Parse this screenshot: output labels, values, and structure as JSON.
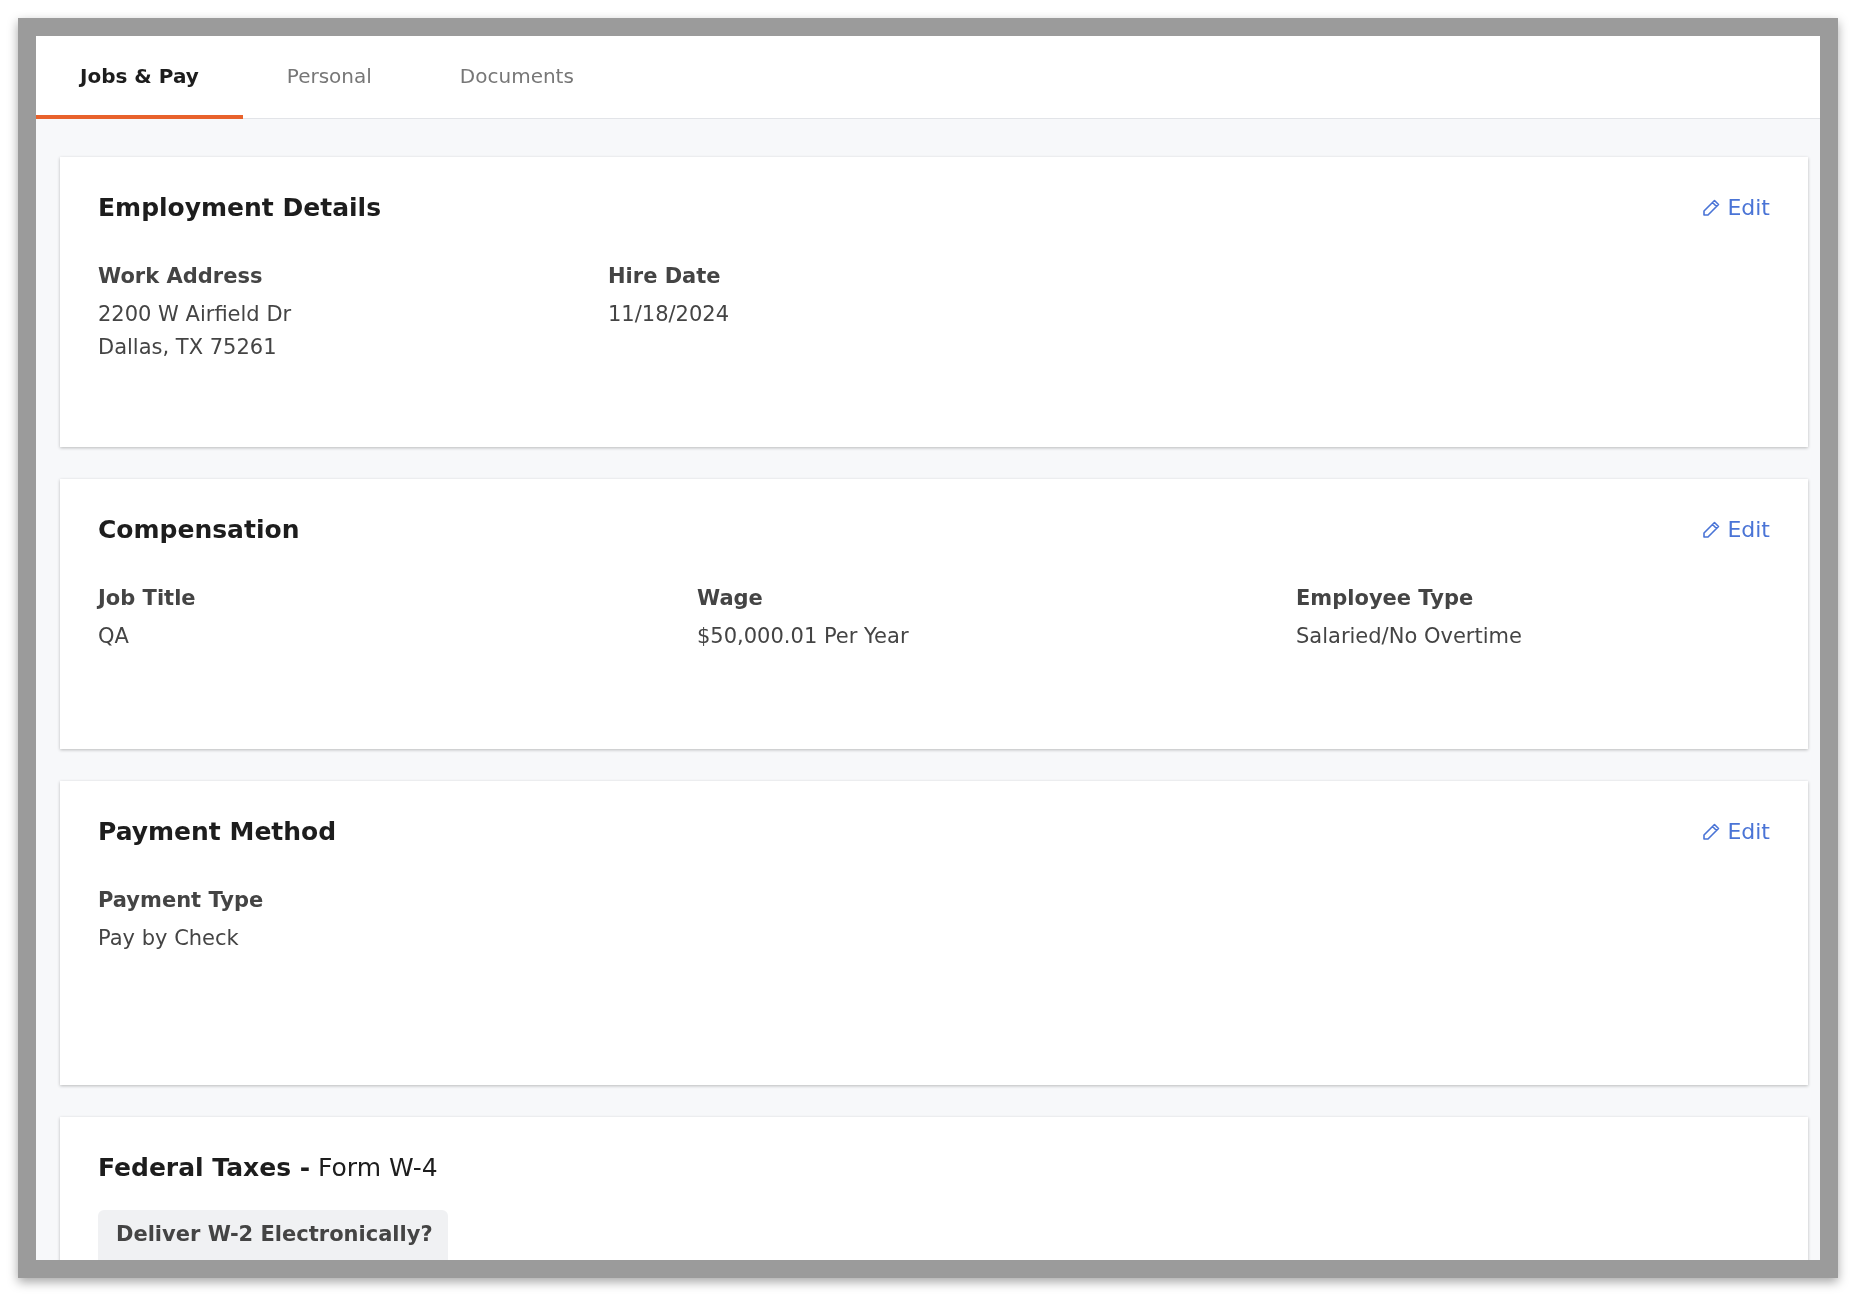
{
  "tabs": [
    {
      "label": "Jobs & Pay",
      "selected": true
    },
    {
      "label": "Personal",
      "selected": false
    },
    {
      "label": "Documents",
      "selected": false
    }
  ],
  "sections": [
    {
      "title": "Employment Details",
      "edit": "Edit",
      "kind": "pair",
      "fields": [
        {
          "label": "Work Address",
          "value_lines": [
            "2200 W Airfield Dr",
            "Dallas, TX 75261"
          ]
        },
        {
          "label": "Hire Date",
          "value_lines": [
            "11/18/2024"
          ]
        }
      ]
    },
    {
      "title": "Compensation",
      "edit": "Edit",
      "kind": "thirds",
      "fields": [
        {
          "label": "Job Title",
          "value_lines": [
            "QA"
          ]
        },
        {
          "label": "Wage",
          "value_lines": [
            "$50,000.01 Per Year"
          ]
        },
        {
          "label": "Employee Type",
          "value_lines": [
            "Salaried/No Overtime"
          ]
        }
      ]
    },
    {
      "title": "Payment Method",
      "edit": "Edit",
      "kind": "pair",
      "fields": [
        {
          "label": "Payment Type",
          "value_lines": [
            "Pay by Check"
          ]
        }
      ]
    },
    {
      "title": "**Federal Taxes -** Form W-4",
      "kind": "panel",
      "panel_heading": "Deliver W-2 Electronically?"
    }
  ]
}
